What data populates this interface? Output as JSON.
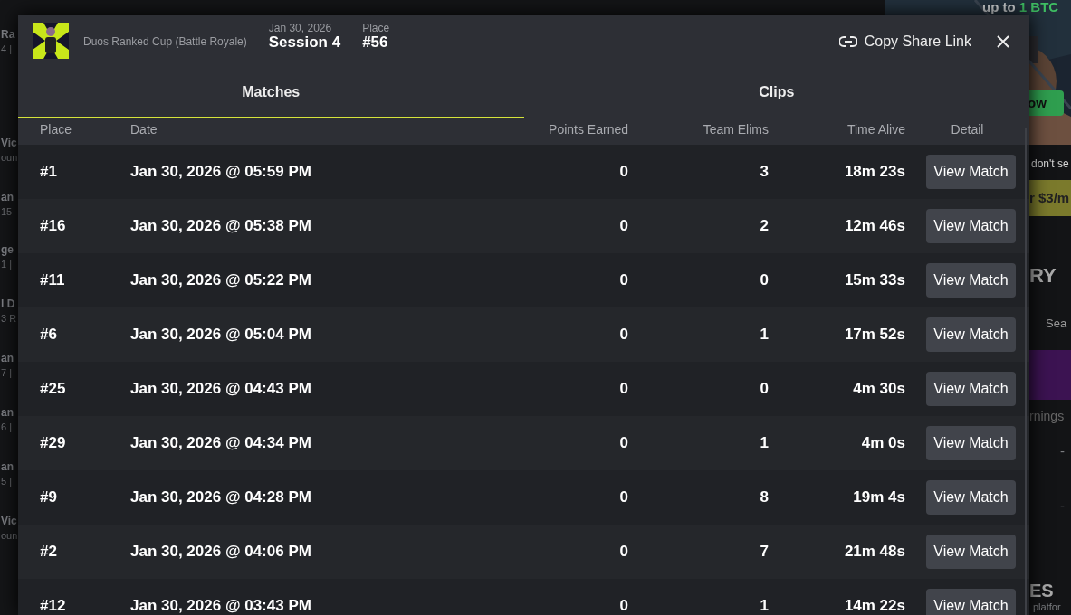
{
  "background_page": {
    "left_fragments": [
      {
        "title": "Ra",
        "sub": "4 |"
      },
      {
        "title": "Vic",
        "sub": "oun"
      },
      {
        "title": "an",
        "sub": "15"
      },
      {
        "title": "ge",
        "sub": "1 |"
      },
      {
        "title": "l D",
        "sub": "3 R"
      },
      {
        "title": "an",
        "sub": "7 |"
      },
      {
        "title": "an",
        "sub": "6 |"
      },
      {
        "title": "an",
        "sub": "5 |"
      },
      {
        "title": "Vic",
        "sub": "oun"
      }
    ],
    "ad": {
      "text": "up to ",
      "highlight": "1 BTC",
      "button": "ow"
    },
    "notice": "don't se",
    "subscribe_button": "r $3/m",
    "section_title": "RY",
    "tab": "Sea",
    "column": "rnings",
    "cells": [
      "-",
      "-"
    ],
    "section_title_2": "ES",
    "subtitle": "platfor"
  },
  "modal": {
    "event": "Duos Ranked Cup (Battle Royale)",
    "date": "Jan 30, 2026",
    "session": "Session 4",
    "place_label": "Place",
    "place": "#56",
    "share": "Copy Share Link",
    "tabs": [
      {
        "label": "Matches",
        "selected": true
      },
      {
        "label": "Clips",
        "selected": false
      }
    ],
    "table": {
      "columns": [
        "Place",
        "Date",
        "Points Earned",
        "Team Elims",
        "Time Alive",
        "Detail"
      ],
      "rows": [
        {
          "place": "#1",
          "date": "Jan 30, 2026 @ 05:59 PM",
          "points": "0",
          "elims": "3",
          "time": "18m 23s",
          "action": "View Match"
        },
        {
          "place": "#16",
          "date": "Jan 30, 2026 @ 05:38 PM",
          "points": "0",
          "elims": "2",
          "time": "12m 46s",
          "action": "View Match"
        },
        {
          "place": "#11",
          "date": "Jan 30, 2026 @ 05:22 PM",
          "points": "0",
          "elims": "0",
          "time": "15m 33s",
          "action": "View Match"
        },
        {
          "place": "#6",
          "date": "Jan 30, 2026 @ 05:04 PM",
          "points": "0",
          "elims": "1",
          "time": "17m 52s",
          "action": "View Match"
        },
        {
          "place": "#25",
          "date": "Jan 30, 2026 @ 04:43 PM",
          "points": "0",
          "elims": "0",
          "time": "4m 30s",
          "action": "View Match"
        },
        {
          "place": "#29",
          "date": "Jan 30, 2026 @ 04:34 PM",
          "points": "0",
          "elims": "1",
          "time": "4m 0s",
          "action": "View Match"
        },
        {
          "place": "#9",
          "date": "Jan 30, 2026 @ 04:28 PM",
          "points": "0",
          "elims": "8",
          "time": "19m 4s",
          "action": "View Match"
        },
        {
          "place": "#2",
          "date": "Jan 30, 2026 @ 04:06 PM",
          "points": "0",
          "elims": "7",
          "time": "21m 48s",
          "action": "View Match"
        },
        {
          "place": "#12",
          "date": "Jan 30, 2026 @ 03:43 PM",
          "points": "0",
          "elims": "1",
          "time": "14m 22s",
          "action": "View Match"
        }
      ]
    }
  }
}
